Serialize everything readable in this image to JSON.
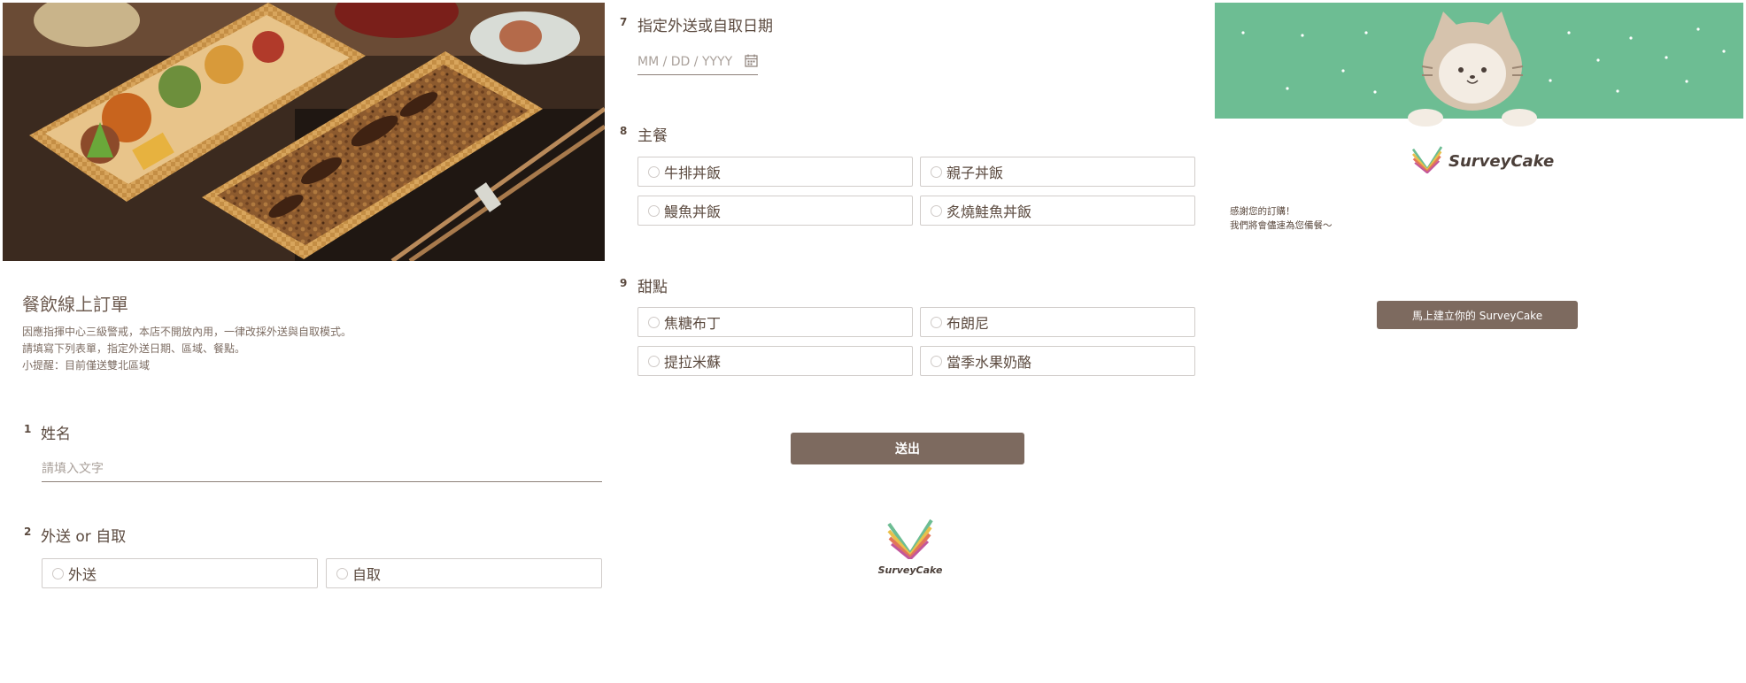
{
  "form": {
    "title": "餐飲線上訂單",
    "description": [
      "因應指揮中心三級警戒，本店不開放內用，一律改採外送與自取模式。",
      "請填寫下列表單，指定外送日期、區域、餐點。",
      "小提醒：目前僅送雙北區域"
    ],
    "questions": {
      "name": {
        "number": "1",
        "title": "姓名",
        "placeholder": "請填入文字"
      },
      "delivery": {
        "number": "2",
        "title": "外送 or 自取",
        "options": [
          "外送",
          "自取"
        ]
      },
      "date": {
        "number": "7",
        "title": "指定外送或自取日期",
        "placeholder": "MM / DD / YYYY"
      },
      "main": {
        "number": "8",
        "title": "主餐",
        "options": [
          "牛排丼飯",
          "親子丼飯",
          "鰻魚丼飯",
          "炙燒鮭魚丼飯"
        ]
      },
      "dessert": {
        "number": "9",
        "title": "甜點",
        "options": [
          "焦糖布丁",
          "布朗尼",
          "提拉米蘇",
          "當季水果奶酪"
        ]
      }
    },
    "submit_label": "送出"
  },
  "brand": {
    "name": "SurveyCake"
  },
  "thanks": {
    "lines": [
      "感謝您的訂購！",
      "我們將會儘速為您備餐～"
    ],
    "cta_label": "馬上建立你的 SurveyCake"
  },
  "icons": {
    "calendar": "calendar-icon",
    "logo": "surveycake-logo-icon",
    "mascot": "cat-mascot-icon"
  },
  "colors": {
    "primary_button": "#7d6a5f",
    "text": "#5b4a3f",
    "banner_green": "#6dbd93",
    "option_border": "#d1cdca"
  }
}
